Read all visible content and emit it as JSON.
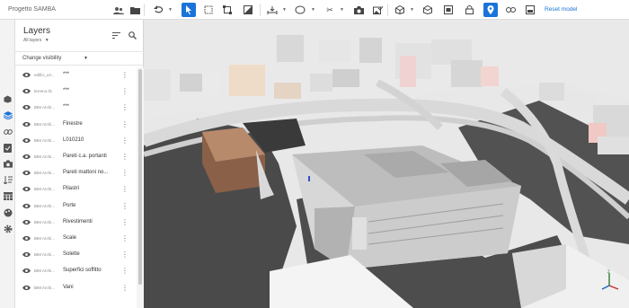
{
  "project": {
    "title": "Progetto SAMBA"
  },
  "toolbar": {
    "reset_label": "Reset model"
  },
  "panel": {
    "title": "Layers",
    "subtitle": "All layers",
    "change_visibility": "Change visibility",
    "layers": [
      {
        "type": "edifici_x3...",
        "name": "***"
      },
      {
        "type": "terreno.ifc",
        "name": "***"
      },
      {
        "type": "BIM Archi...",
        "name": "***"
      },
      {
        "type": "BIM Archi...",
        "name": "Finestre"
      },
      {
        "type": "BIM Archi...",
        "name": "L010210"
      },
      {
        "type": "BIM Archi...",
        "name": "Pareti c.a. portanti"
      },
      {
        "type": "BIM Archi...",
        "name": "Pareti mattoni no..."
      },
      {
        "type": "BIM Archi...",
        "name": "Pilastri"
      },
      {
        "type": "BIM Archi...",
        "name": "Porte"
      },
      {
        "type": "BIM Archi...",
        "name": "Rivestimenti"
      },
      {
        "type": "BIM Archi...",
        "name": "Scale"
      },
      {
        "type": "BIM Archi...",
        "name": "Solette"
      },
      {
        "type": "BIM Archi...",
        "name": "Superfici soffitto"
      },
      {
        "type": "BIM Archi...",
        "name": "Vani"
      }
    ]
  },
  "colors": {
    "accent": "#1a73d9",
    "viewport_bg": "#ececec",
    "road": "#4a4a4a"
  }
}
